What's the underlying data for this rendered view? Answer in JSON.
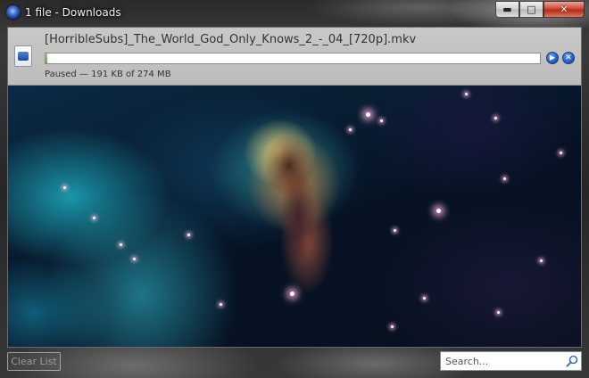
{
  "window": {
    "title": "1 file - Downloads",
    "buttons": {
      "minimize": "▬",
      "maximize": "□",
      "close": "✕"
    }
  },
  "download": {
    "file_name": "[HorribleSubs]_The_World_God_Only_Knows_2_-_04_[720p].mkv",
    "status": "Paused — 191 KB of 274 MB",
    "progress_fraction": 0.0007,
    "file_icon": "video-file-icon",
    "resume_icon": "play-icon",
    "cancel_icon": "cancel-icon"
  },
  "footer": {
    "clear_list_label": "Clear List",
    "search_placeholder": "Search..."
  },
  "colors": {
    "selected_row": "#c9c8c6",
    "accent_blue": "#1f5fc4",
    "close_button": "#cf4a32"
  }
}
